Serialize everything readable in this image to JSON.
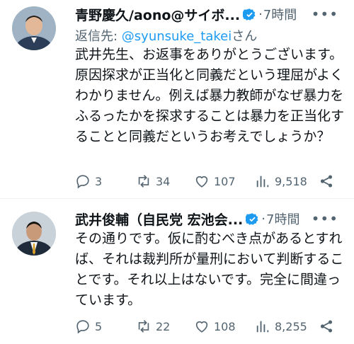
{
  "tweets": [
    {
      "author_name": "青野慶久/aono@サイボ...",
      "time": "7時間",
      "reply_prefix": "返信先: ",
      "reply_handle": "@syunsuke_takei",
      "reply_suffix": "さん",
      "text": "武井先生、お返事をありがとうございます。原因探求が正当化と同義だという理屈がよくわかりません。例えば暴力教師がなぜ暴力をふるったかを探求することは暴力を正当化することと同義だというお考えでしょうか？",
      "replies": "3",
      "retweets": "34",
      "likes": "107",
      "views": "9,518"
    },
    {
      "author_name": "武井俊輔（自民党 宏池会...",
      "time": "7時間",
      "text": "その通りです。仮に酌むべき点があるとすれば、それは裁判所が量刑において判断することです。それ以上はないです。完全に間違っています。",
      "replies": "5",
      "retweets": "22",
      "likes": "108",
      "views": "8,255"
    }
  ],
  "icons": {
    "verified": "verified-badge-icon",
    "reply": "reply-icon",
    "retweet": "retweet-icon",
    "like": "heart-icon",
    "views": "views-icon",
    "share": "share-icon",
    "more": "more-icon"
  },
  "colors": {
    "verified": "#1d9bf0",
    "secondary_text": "#536471",
    "link": "#1d9bf0"
  }
}
